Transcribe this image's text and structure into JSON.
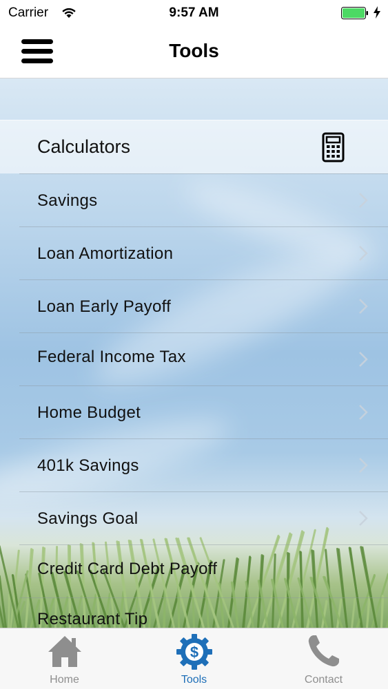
{
  "status_bar": {
    "carrier": "Carrier",
    "time": "9:57 AM"
  },
  "nav": {
    "title": "Tools",
    "menu_icon": "hamburger-menu-icon"
  },
  "section": {
    "title": "Calculators",
    "icon": "calculator-icon"
  },
  "items": [
    {
      "label": "Savings"
    },
    {
      "label": "Loan Amortization"
    },
    {
      "label": "Loan Early Payoff"
    },
    {
      "label": "Federal Income Tax"
    },
    {
      "label": "Home Budget"
    },
    {
      "label": "401k Savings"
    },
    {
      "label": "Savings Goal"
    },
    {
      "label": "Credit Card Debt Payoff"
    },
    {
      "label": "Restaurant Tip"
    }
  ],
  "tabs": [
    {
      "label": "Home",
      "icon": "house-icon",
      "active": false
    },
    {
      "label": "Tools",
      "icon": "dollar-gear-icon",
      "active": true
    },
    {
      "label": "Contact",
      "icon": "phone-icon",
      "active": false
    }
  ],
  "colors": {
    "accent": "#1e6fb8",
    "battery": "#4cd964"
  }
}
